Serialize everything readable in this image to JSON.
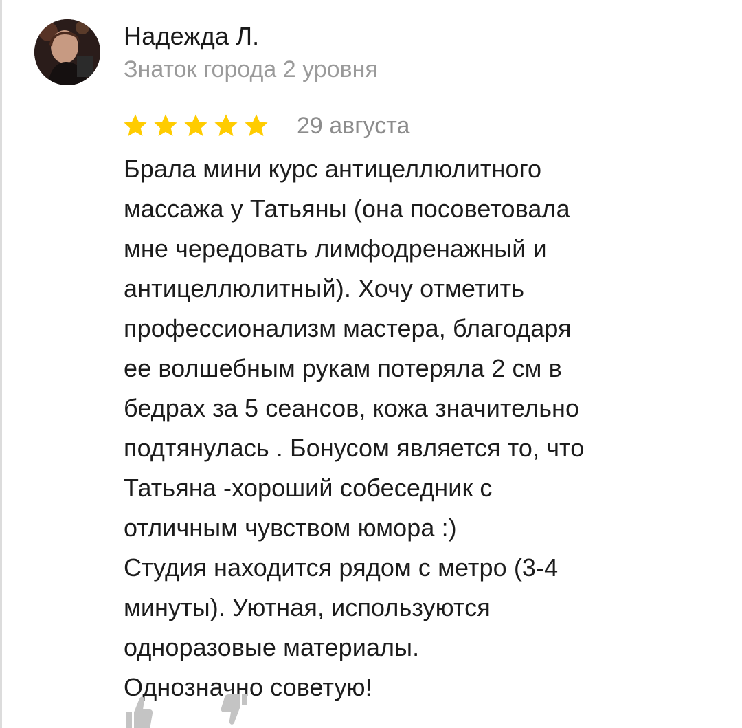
{
  "author": {
    "name": "Надежда Л.",
    "level": "Знаток города 2 уровня"
  },
  "review": {
    "rating": 5,
    "rating_max": 5,
    "date": "29 августа",
    "text": "Брала мини курс антицеллюлитного\nмассажа у Татьяны (она посоветовала\nмне чередовать лимфодренажный и\nантицеллюлитный). Хочу отметить\nпрофессионализм мастера, благодаря\nее волшебным рукам потеряла 2 см в\nбедрах за 5 сеансов, кожа значительно\nподтянулась . Бонусом является то, что\nТатьяна -хороший собеседник с\nотличным чувством юмора :)\nСтудия находится рядом с метро (3-4\nминуты). Уютная, используются\nодноразовые материалы.\nОднозначно советую!"
  },
  "colors": {
    "star": "#FFCC00",
    "level_text": "#9a9a9a",
    "date_text": "#8c8c8c",
    "reaction_icon": "#c4c4c4"
  },
  "icons": {
    "like": "thumbs-up-icon",
    "dislike": "thumbs-down-icon"
  }
}
